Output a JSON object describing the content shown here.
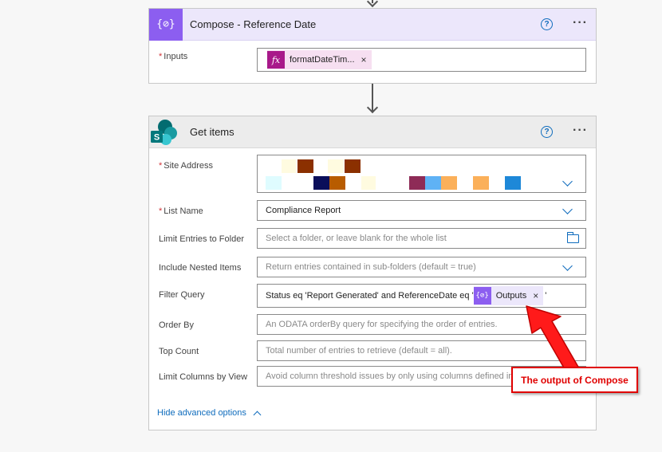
{
  "compose": {
    "title": "Compose - Reference Date",
    "icon": "variable-icon",
    "icon_glyph": "{⊘}",
    "inputs_label": "Inputs",
    "inputs_token": "formatDateTim...",
    "token_icon_glyph": "fx"
  },
  "get_items": {
    "title": "Get items",
    "icon": "sharepoint-icon",
    "fields": {
      "site_address": {
        "label": "Site Address"
      },
      "list_name": {
        "label": "List Name",
        "value": "Compliance Report"
      },
      "limit_folder": {
        "label": "Limit Entries to Folder",
        "placeholder": "Select a folder, or leave blank for the whole list"
      },
      "nested_items": {
        "label": "Include Nested Items",
        "placeholder": "Return entries contained in sub-folders (default = true)"
      },
      "filter_query": {
        "label": "Filter Query",
        "value": "Status eq 'Report Generated' and ReferenceDate eq '",
        "token": "Outputs",
        "suffix": "'"
      },
      "order_by": {
        "label": "Order By",
        "placeholder": "An ODATA orderBy query for specifying the order of entries."
      },
      "top_count": {
        "label": "Top Count",
        "placeholder": "Total number of entries to retrieve (default = all)."
      },
      "limit_columns": {
        "label": "Limit Columns by View",
        "placeholder": "Avoid column threshold issues by only using columns defined in a view"
      }
    },
    "hide_advanced": "Hide advanced options"
  },
  "common": {
    "required_marker": "*",
    "help_glyph": "?",
    "more_glyph": "···",
    "close_glyph": "×"
  },
  "annotation": {
    "text": "The output of Compose",
    "color": "#e00000"
  },
  "colors": {
    "compose_accent": "#8c5ef0",
    "expression_token": "#a8198a",
    "link_blue": "#0f6cbd",
    "sharepoint_teal": "#03787c"
  }
}
